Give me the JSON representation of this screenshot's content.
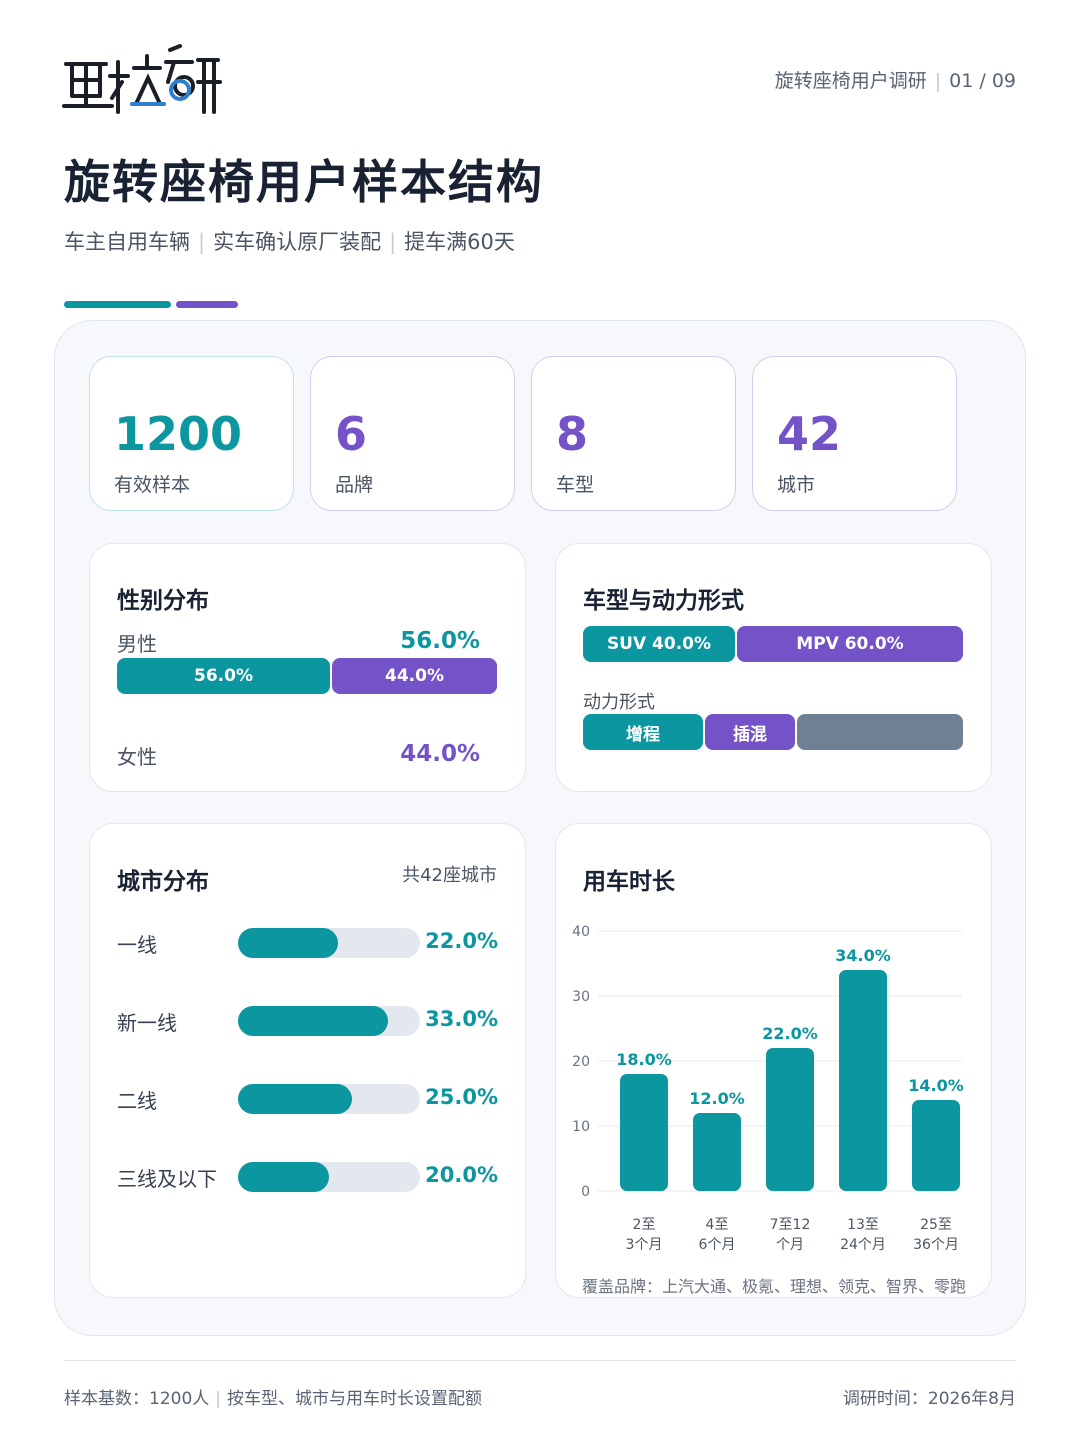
{
  "header": {
    "page_meta_left": "旋转座椅用户调研",
    "page_meta_right": "01 / 09",
    "title": "旋转座椅用户样本结构",
    "subtitle_parts": [
      "车主自用车辆",
      "实车确认原厂装配",
      "提车满60天"
    ]
  },
  "stats": [
    {
      "value": "1200",
      "label": "有效样本",
      "accent": "teal"
    },
    {
      "value": "6",
      "label": "品牌",
      "accent": "purple"
    },
    {
      "value": "8",
      "label": "车型",
      "accent": "purple"
    },
    {
      "value": "42",
      "label": "城市",
      "accent": "purple"
    }
  ],
  "gender": {
    "title": "性别分布",
    "male_label": "男性",
    "male_pct": "56.0%",
    "female_label": "女性",
    "female_pct": "44.0%",
    "bar_male": "56.0%",
    "bar_female": "44.0%",
    "male_share": 0.56
  },
  "vehicle": {
    "title": "车型与动力形式",
    "suv": "SUV 40.0%",
    "mpv": "MPV 60.0%",
    "suv_share": 0.4,
    "power_label": "动力形式",
    "power_segments": [
      "增程",
      "插混",
      ""
    ]
  },
  "city": {
    "title": "城市分布",
    "note": "共42座城市"
  },
  "usage": {
    "title": "用车时长",
    "coverage": "覆盖品牌：上汽大通、极氪、理想、领克、智界、零跑"
  },
  "footer": {
    "left_a": "样本基数：1200人",
    "left_b": "按车型、城市与用车时长设置配额",
    "right": "调研时间：2026年8月"
  },
  "colors": {
    "teal": "#0b96a0",
    "purple": "#7452c8",
    "grey": "#6f7f94",
    "track": "#e3e8ef"
  },
  "chart_data": [
    {
      "type": "bar",
      "title": "城市分布",
      "orientation": "horizontal",
      "categories": [
        "一线",
        "新一线",
        "二线",
        "三线及以下"
      ],
      "values": [
        22.0,
        33.0,
        25.0,
        20.0
      ],
      "labels": [
        "22.0%",
        "33.0%",
        "25.0%",
        "20.0%"
      ],
      "xlim": [
        0,
        40
      ]
    },
    {
      "type": "bar",
      "title": "用车时长",
      "categories": [
        [
          "2至",
          "3个月"
        ],
        [
          "4至",
          "6个月"
        ],
        [
          "7至12",
          "个月"
        ],
        [
          "13至",
          "24个月"
        ],
        [
          "25至",
          "36个月"
        ]
      ],
      "values": [
        18.0,
        12.0,
        22.0,
        34.0,
        14.0
      ],
      "labels": [
        "18.0%",
        "12.0%",
        "22.0%",
        "34.0%",
        "14.0%"
      ],
      "yticks": [
        0,
        10,
        20,
        30,
        40
      ],
      "ylim": [
        0,
        40
      ],
      "grid": true
    }
  ]
}
